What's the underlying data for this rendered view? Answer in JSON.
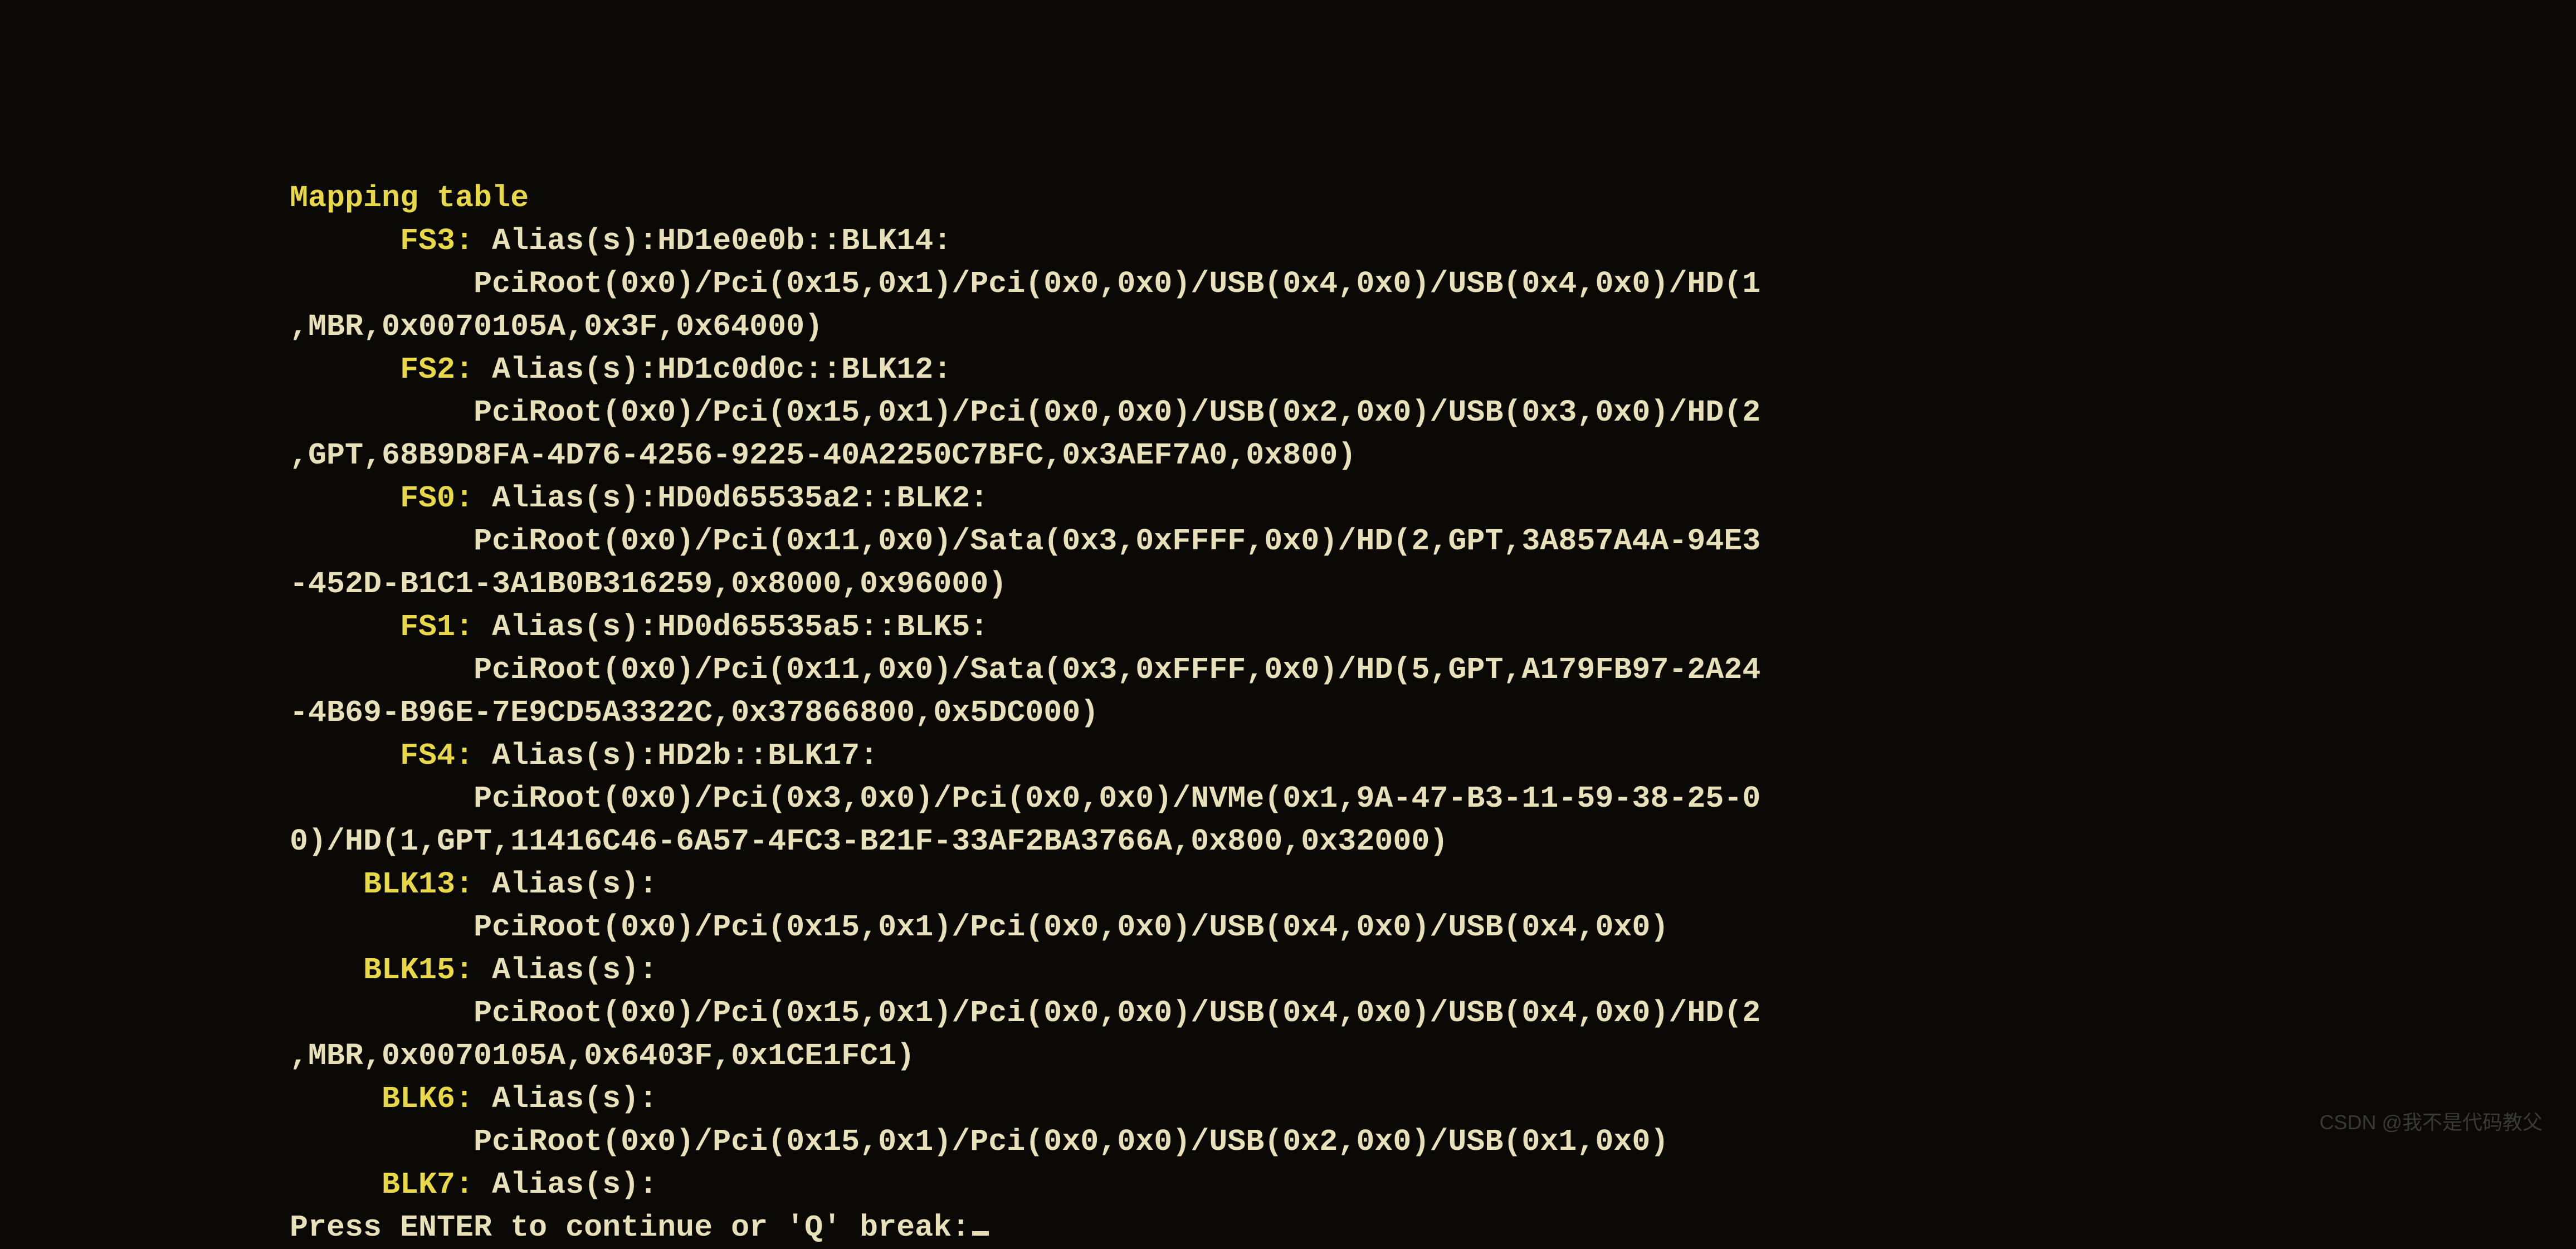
{
  "title": "Mapping table",
  "lines": [
    {
      "indent": "      ",
      "key": "FS3:",
      "rest": " Alias(s):HD1e0e0b::BLK14:"
    },
    {
      "indent": "          ",
      "key": "",
      "rest": "PciRoot(0x0)/Pci(0x15,0x1)/Pci(0x0,0x0)/USB(0x4,0x0)/USB(0x4,0x0)/HD(1"
    },
    {
      "indent": "",
      "key": "",
      "rest": ",MBR,0x0070105A,0x3F,0x64000)"
    },
    {
      "indent": "      ",
      "key": "FS2:",
      "rest": " Alias(s):HD1c0d0c::BLK12:"
    },
    {
      "indent": "          ",
      "key": "",
      "rest": "PciRoot(0x0)/Pci(0x15,0x1)/Pci(0x0,0x0)/USB(0x2,0x0)/USB(0x3,0x0)/HD(2"
    },
    {
      "indent": "",
      "key": "",
      "rest": ",GPT,68B9D8FA-4D76-4256-9225-40A2250C7BFC,0x3AEF7A0,0x800)"
    },
    {
      "indent": "      ",
      "key": "FS0:",
      "rest": " Alias(s):HD0d65535a2::BLK2:"
    },
    {
      "indent": "          ",
      "key": "",
      "rest": "PciRoot(0x0)/Pci(0x11,0x0)/Sata(0x3,0xFFFF,0x0)/HD(2,GPT,3A857A4A-94E3"
    },
    {
      "indent": "",
      "key": "",
      "rest": "-452D-B1C1-3A1B0B316259,0x8000,0x96000)"
    },
    {
      "indent": "      ",
      "key": "FS1:",
      "rest": " Alias(s):HD0d65535a5::BLK5:"
    },
    {
      "indent": "          ",
      "key": "",
      "rest": "PciRoot(0x0)/Pci(0x11,0x0)/Sata(0x3,0xFFFF,0x0)/HD(5,GPT,A179FB97-2A24"
    },
    {
      "indent": "",
      "key": "",
      "rest": "-4B69-B96E-7E9CD5A3322C,0x37866800,0x5DC000)"
    },
    {
      "indent": "      ",
      "key": "FS4:",
      "rest": " Alias(s):HD2b::BLK17:"
    },
    {
      "indent": "          ",
      "key": "",
      "rest": "PciRoot(0x0)/Pci(0x3,0x0)/Pci(0x0,0x0)/NVMe(0x1,9A-47-B3-11-59-38-25-0"
    },
    {
      "indent": "",
      "key": "",
      "rest": "0)/HD(1,GPT,11416C46-6A57-4FC3-B21F-33AF2BA3766A,0x800,0x32000)"
    },
    {
      "indent": "    ",
      "key": "BLK13:",
      "rest": " Alias(s):"
    },
    {
      "indent": "          ",
      "key": "",
      "rest": "PciRoot(0x0)/Pci(0x15,0x1)/Pci(0x0,0x0)/USB(0x4,0x0)/USB(0x4,0x0)"
    },
    {
      "indent": "    ",
      "key": "BLK15:",
      "rest": " Alias(s):"
    },
    {
      "indent": "          ",
      "key": "",
      "rest": "PciRoot(0x0)/Pci(0x15,0x1)/Pci(0x0,0x0)/USB(0x4,0x0)/USB(0x4,0x0)/HD(2"
    },
    {
      "indent": "",
      "key": "",
      "rest": ",MBR,0x0070105A,0x6403F,0x1CE1FC1)"
    },
    {
      "indent": "     ",
      "key": "BLK6:",
      "rest": " Alias(s):"
    },
    {
      "indent": "          ",
      "key": "",
      "rest": "PciRoot(0x0)/Pci(0x15,0x1)/Pci(0x0,0x0)/USB(0x2,0x0)/USB(0x1,0x0)"
    },
    {
      "indent": "     ",
      "key": "BLK7:",
      "rest": " Alias(s):"
    }
  ],
  "prompt": "Press ENTER to continue or 'Q' break:",
  "watermark": "CSDN @我不是代码教父"
}
